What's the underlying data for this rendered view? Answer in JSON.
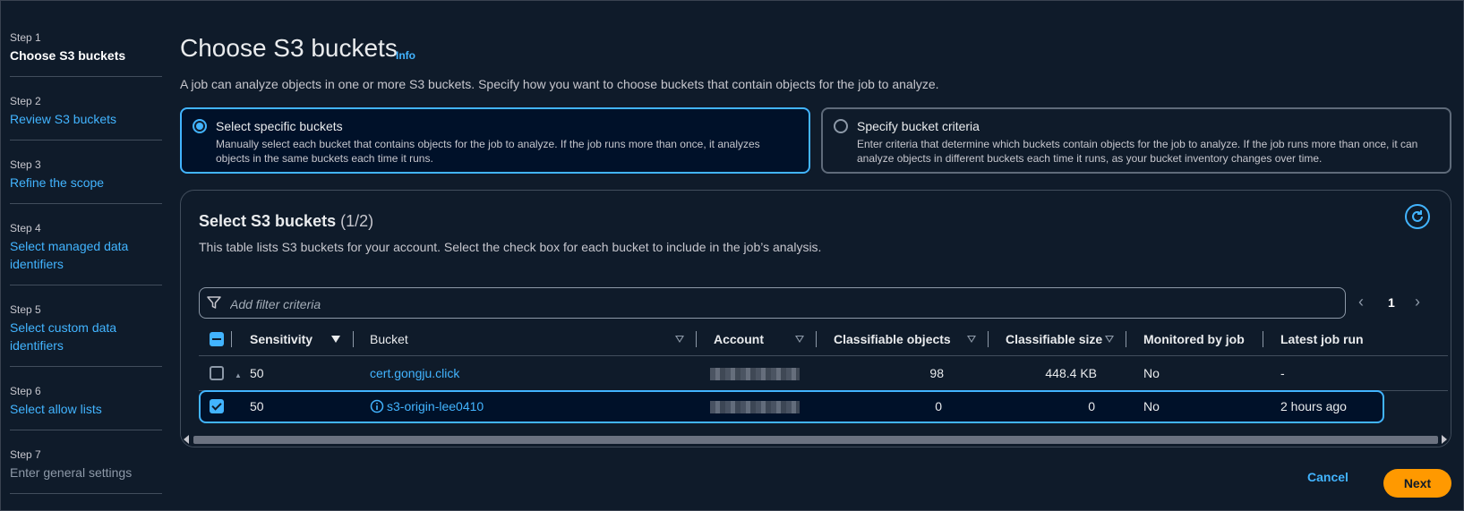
{
  "nav": {
    "steps": [
      {
        "num": "Step 1",
        "title": "Choose S3 buckets"
      },
      {
        "num": "Step 2",
        "title": "Review S3 buckets"
      },
      {
        "num": "Step 3",
        "title": "Refine the scope"
      },
      {
        "num": "Step 4",
        "title": "Select managed data identifiers"
      },
      {
        "num": "Step 5",
        "title": "Select custom data identifiers"
      },
      {
        "num": "Step 6",
        "title": "Select allow lists"
      },
      {
        "num": "Step 7",
        "title": "Enter general settings"
      }
    ]
  },
  "header": {
    "title": "Choose S3 buckets",
    "info": "Info",
    "description": "A job can analyze objects in one or more S3 buckets. Specify how you want to choose buckets that contain objects for the job to analyze."
  },
  "options": {
    "specific": {
      "label": "Select specific buckets",
      "description": "Manually select each bucket that contains objects for the job to analyze. If the job runs more than once, it analyzes objects in the same buckets each time it runs."
    },
    "criteria": {
      "label": "Specify bucket criteria",
      "description": "Enter criteria that determine which buckets contain objects for the job to analyze. If the job runs more than once, it can analyze objects in different buckets each time it runs, as your bucket inventory changes over time."
    }
  },
  "table": {
    "title": "Select S3 buckets",
    "count": "(1/2)",
    "description": "This table lists S3 buckets for your account. Select the check box for each bucket to include in the job’s analysis.",
    "filter_placeholder": "Add filter criteria",
    "page": "1",
    "columns": {
      "sensitivity": "Sensitivity",
      "bucket": "Bucket",
      "account": "Account",
      "classifiable_objects": "Classifiable objects",
      "classifiable_size": "Classifiable size",
      "monitored": "Monitored by job",
      "latest_run": "Latest job run"
    },
    "rows": [
      {
        "sensitivity": "50",
        "bucket": "cert.gongju.click",
        "objects": "98",
        "size": "448.4 KB",
        "monitored": "No",
        "latest": "-"
      },
      {
        "sensitivity": "50",
        "bucket": "s3-origin-lee0410",
        "objects": "0",
        "size": "0",
        "monitored": "No",
        "latest": "2 hours ago"
      }
    ]
  },
  "footer": {
    "cancel": "Cancel",
    "next": "Next"
  },
  "colors": {
    "background": "#0f1b2a",
    "accent": "#42b4ff",
    "primary_button": "#ff9900"
  }
}
